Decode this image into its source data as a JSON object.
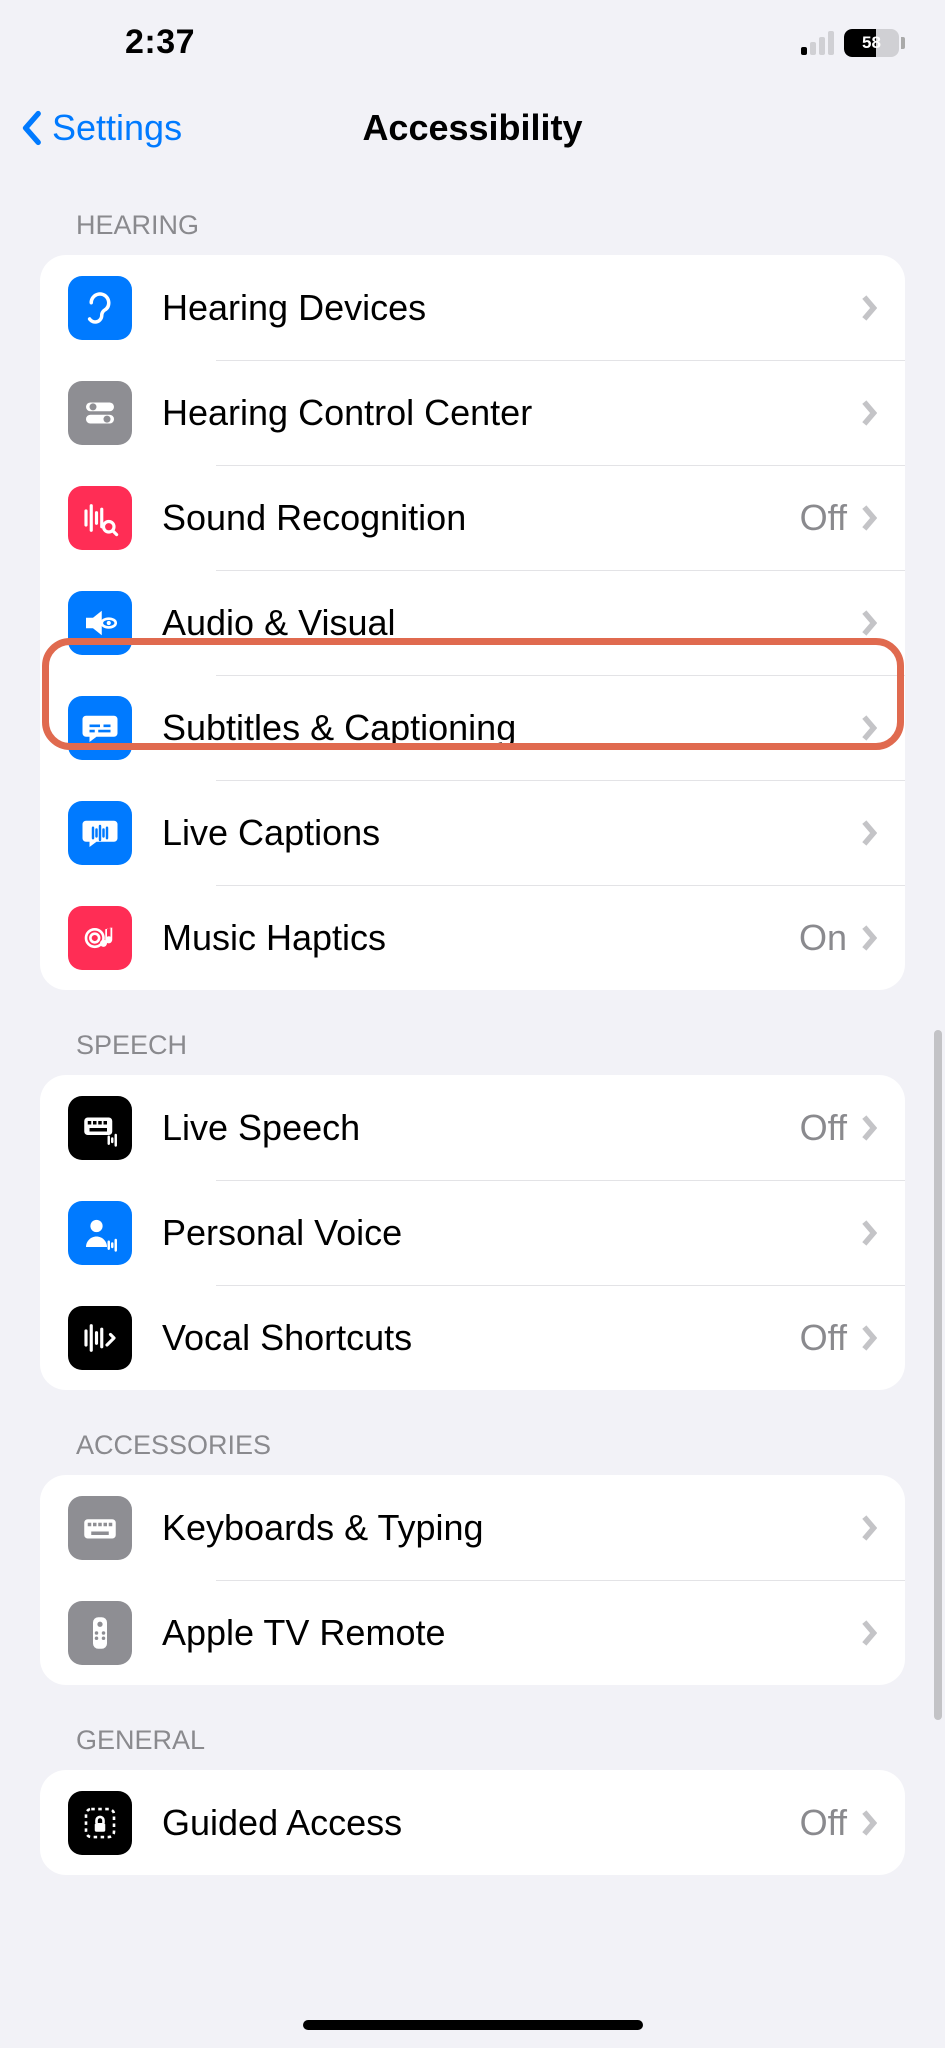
{
  "status": {
    "time": "2:37",
    "battery": "58"
  },
  "nav": {
    "back": "Settings",
    "title": "Accessibility"
  },
  "sections": {
    "hearing": {
      "header": "HEARING",
      "items": [
        {
          "label": "Hearing Devices",
          "value": ""
        },
        {
          "label": "Hearing Control Center",
          "value": ""
        },
        {
          "label": "Sound Recognition",
          "value": "Off"
        },
        {
          "label": "Audio & Visual",
          "value": ""
        },
        {
          "label": "Subtitles & Captioning",
          "value": ""
        },
        {
          "label": "Live Captions",
          "value": ""
        },
        {
          "label": "Music Haptics",
          "value": "On"
        }
      ]
    },
    "speech": {
      "header": "SPEECH",
      "items": [
        {
          "label": "Live Speech",
          "value": "Off"
        },
        {
          "label": "Personal Voice",
          "value": ""
        },
        {
          "label": "Vocal Shortcuts",
          "value": "Off"
        }
      ]
    },
    "accessories": {
      "header": "ACCESSORIES",
      "items": [
        {
          "label": "Keyboards & Typing",
          "value": ""
        },
        {
          "label": "Apple TV Remote",
          "value": ""
        }
      ]
    },
    "general": {
      "header": "GENERAL",
      "items": [
        {
          "label": "Guided Access",
          "value": "Off"
        }
      ]
    }
  }
}
